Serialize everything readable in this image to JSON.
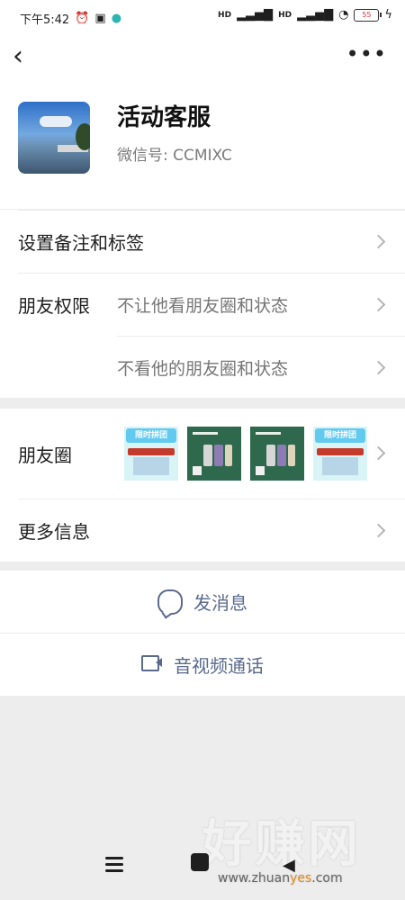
{
  "status_bar": {
    "time": "下午5:42",
    "signal_1": "HD",
    "signal_2": "HD",
    "battery": "55"
  },
  "header": {
    "back_icon": "chevron-left-icon",
    "more_icon": "more-dots-icon"
  },
  "profile": {
    "name": "活动客服",
    "wechat_id": "微信号: CCMIXC"
  },
  "settings": {
    "remark_label": "设置备注和标签",
    "permission_label": "朋友权限",
    "permission_1": "不让他看朋友圈和状态",
    "permission_2": "不看他的朋友圈和状态"
  },
  "moments": {
    "label": "朋友圈",
    "thumb_text_1": "限时拼团",
    "thumb_text_2": "限时拼团"
  },
  "more_info": {
    "label": "更多信息"
  },
  "actions": {
    "message_label": "发消息",
    "video_label": "音视频通话"
  },
  "watermark": {
    "brand": "好赚网",
    "url_prefix": "www.zhuan",
    "url_highlight": "yes",
    "url_suffix": ".com"
  }
}
